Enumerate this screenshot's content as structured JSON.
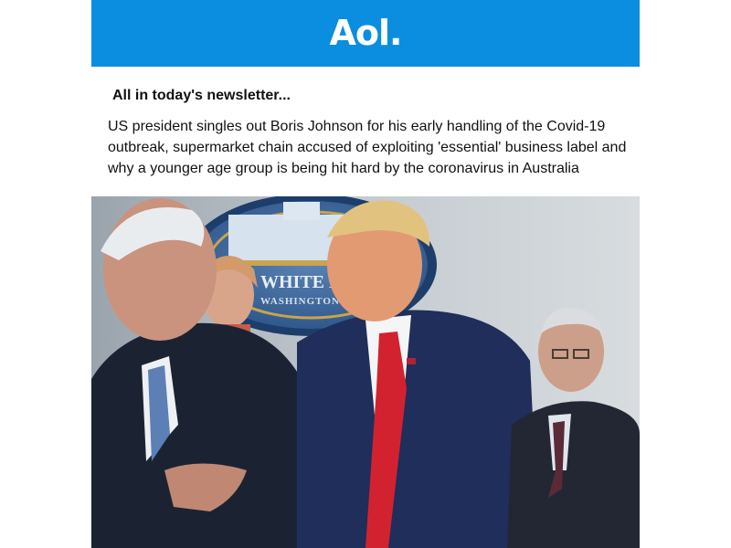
{
  "brand": {
    "logo_text": "Aol.",
    "header_color": "#0b8ee0"
  },
  "newsletter": {
    "heading": "All in today's newsletter...",
    "summary": "US president singles out Boris Johnson for his early handling of the Covid-19 outbreak, supermarket chain accused of exploiting 'essential' business label and why a younger age group is being hit hard by the coronavirus in Australia"
  },
  "photo": {
    "seal_text_line1": "WHITE H",
    "seal_text_line2": "WASHINGTON"
  }
}
